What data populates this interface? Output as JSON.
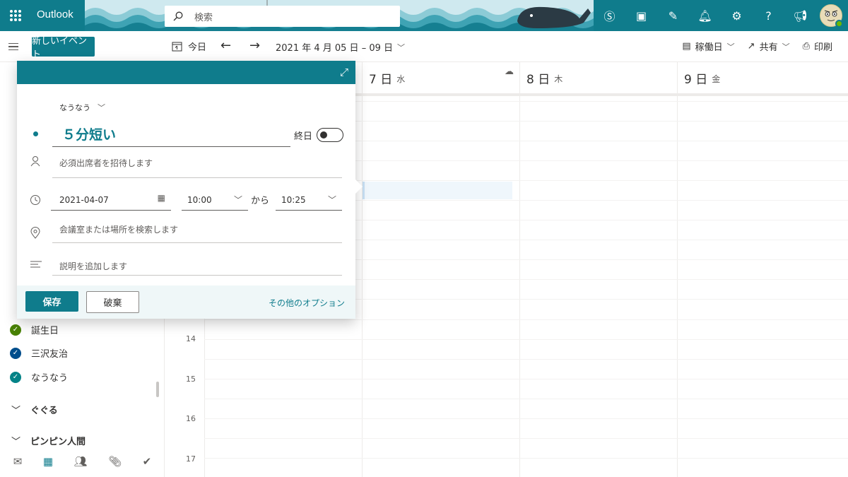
{
  "topbar": {
    "app_name": "Outlook",
    "search_placeholder": "検索"
  },
  "command": {
    "new_event": "新しいイベント",
    "today": "今日",
    "date_range": "2021 年 4 月 05 日 – 09 日",
    "workweek": "稼働日",
    "share": "共有",
    "print": "印刷"
  },
  "sidebar": {
    "calendars": [
      {
        "name": "誕生日",
        "color": "#498205"
      },
      {
        "name": "三沢友治",
        "color": "#004e8c"
      },
      {
        "name": "なうなう",
        "color": "#038387"
      }
    ],
    "groups": [
      "ぐぐる",
      "ピンピン人間"
    ]
  },
  "calendar": {
    "days": [
      {
        "num": "7 日",
        "dow": "水"
      },
      {
        "num": "8 日",
        "dow": "木"
      },
      {
        "num": "9 日",
        "dow": "金"
      }
    ],
    "hours": [
      "14",
      "15",
      "16",
      "17"
    ]
  },
  "popup": {
    "calendar_name": "なうなう",
    "title": "５分短い",
    "all_day_label": "終日",
    "attendees_placeholder": "必須出席者を招待します",
    "date": "2021-04-07",
    "start_time": "10:00",
    "to_label": "から",
    "end_time": "10:25",
    "location_placeholder": "会議室または場所を検索します",
    "description_placeholder": "説明を追加します",
    "save": "保存",
    "discard": "破棄",
    "more_options": "その他のオプション"
  },
  "colors": {
    "accent": "#0f7c8c",
    "brand_header": "#0f7c8c"
  }
}
